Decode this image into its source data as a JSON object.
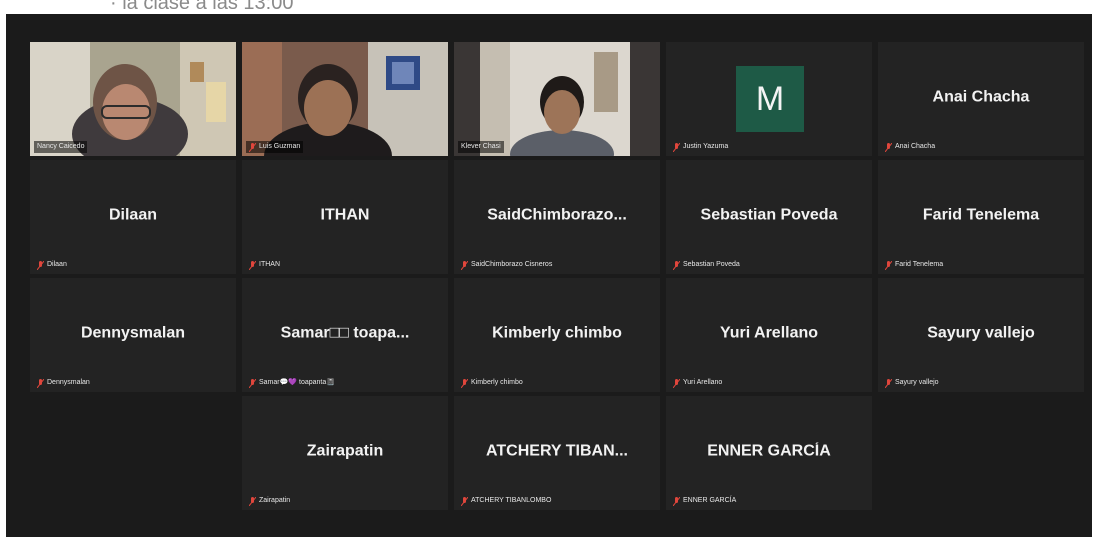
{
  "header": {
    "partial_text": "· la clase a las 13:00"
  },
  "participants": [
    {
      "name": "Nancy Caicedo",
      "label": "Nancy Caicedo",
      "video": true,
      "active": true
    },
    {
      "name": "Luis Guzman",
      "label": "Luis Guzman",
      "video": true
    },
    {
      "name": "Klever Chasi",
      "label": "Klever Chasi",
      "video": true
    },
    {
      "name": "M",
      "label": "Justin Yazuma",
      "avatar_initial": "M",
      "avatar_color": "#1e5a46"
    },
    {
      "name": "Anai Chacha",
      "label": "Anai Chacha"
    },
    {
      "name": "Dilaan",
      "label": "Dilaan"
    },
    {
      "name": "ITHAN",
      "label": "ITHAN"
    },
    {
      "name": "SaidChimborazo...",
      "label": "SaidChimborazo Cisneros"
    },
    {
      "name": "Sebastian Poveda",
      "label": "Sebastian Poveda"
    },
    {
      "name": "Farid Tenelema",
      "label": "Farid Tenelema"
    },
    {
      "name": "Dennysmalan",
      "label": "Dennysmalan"
    },
    {
      "name": "Samar□□ toapa...",
      "label": "Samar💬💜 toapanta📓"
    },
    {
      "name": "Kimberly chimbo",
      "label": "Kimberly chimbo"
    },
    {
      "name": "Yuri Arellano",
      "label": "Yuri Arellano"
    },
    {
      "name": "Sayury vallejo",
      "label": "Sayury vallejo"
    },
    {
      "name": "Zairapatin",
      "label": "Zairapatin"
    },
    {
      "name": "ATCHERY TIBAN...",
      "label": "ATCHERY TIBANLOMBO"
    },
    {
      "name": "ENNER GARCÍA",
      "label": "ENNER GARCÍA"
    }
  ],
  "colors": {
    "stage": "#1b1b1b",
    "tile": "#232323",
    "active_border": "#c4d95a",
    "muted_mic": "#e0463c"
  }
}
